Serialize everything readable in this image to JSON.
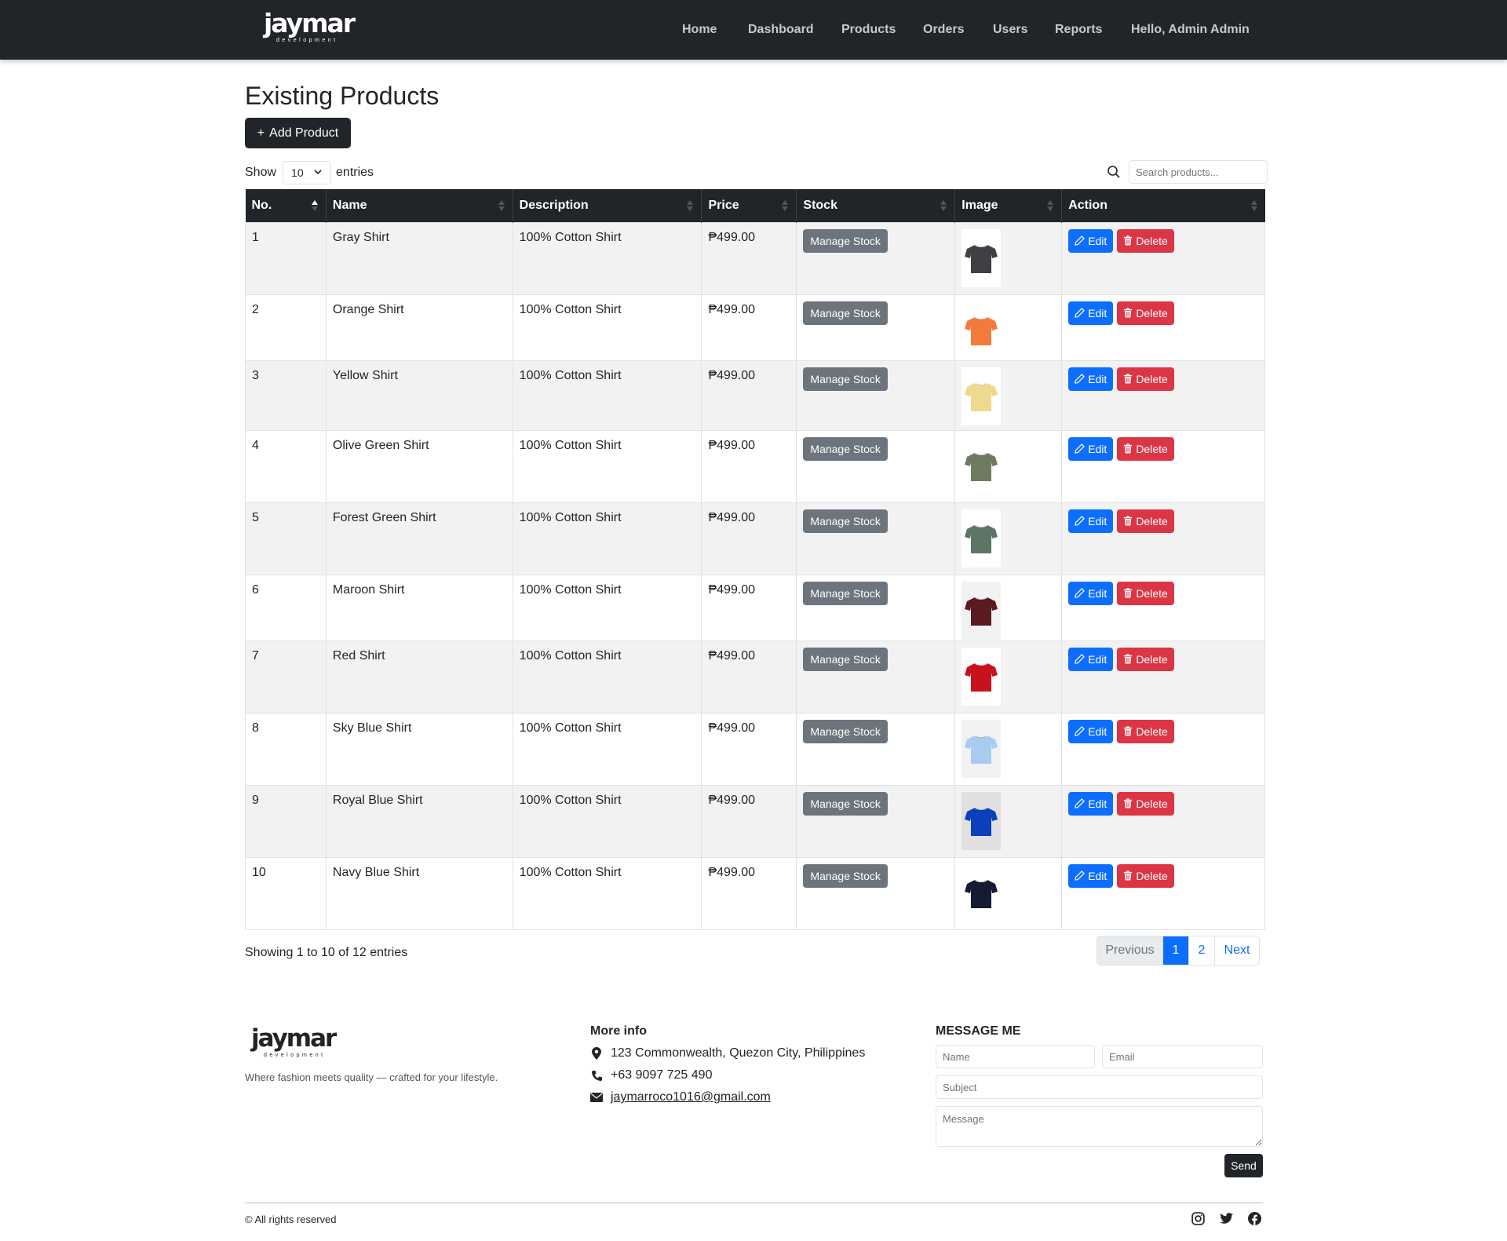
{
  "navbar": {
    "brand": "jaymar",
    "brand_sub": "development",
    "links": [
      "Home",
      "Dashboard",
      "Products",
      "Orders",
      "Users",
      "Reports",
      "Hello, Admin Admin"
    ]
  },
  "main": {
    "title": "Existing Products",
    "add_button": "Add Product",
    "show_label": "Show",
    "entries_label": "entries",
    "page_size": "10",
    "search_placeholder": "Search products...",
    "columns": [
      "No.",
      "Name",
      "Description",
      "Price",
      "Stock",
      "Image",
      "Action"
    ],
    "stock_button": "Manage Stock",
    "edit_button": "Edit",
    "delete_button": "Delete",
    "rows": [
      {
        "no": "1",
        "name": "Gray Shirt",
        "description": "100% Cotton Shirt",
        "price": "₱499.00",
        "color": "#3f3f44",
        "bg": "#ffffff"
      },
      {
        "no": "2",
        "name": "Orange Shirt",
        "description": "100% Cotton Shirt",
        "price": "₱499.00",
        "color": "#f47a3c",
        "bg": "#ffffff"
      },
      {
        "no": "3",
        "name": "Yellow Shirt",
        "description": "100% Cotton Shirt",
        "price": "₱499.00",
        "color": "#efd98c",
        "bg": "#ffffff"
      },
      {
        "no": "4",
        "name": "Olive Green Shirt",
        "description": "100% Cotton Shirt",
        "price": "₱499.00",
        "color": "#6e7b5e",
        "bg": "#ffffff"
      },
      {
        "no": "5",
        "name": "Forest Green Shirt",
        "description": "100% Cotton Shirt",
        "price": "₱499.00",
        "color": "#5d7563",
        "bg": "#ffffff"
      },
      {
        "no": "6",
        "name": "Maroon Shirt",
        "description": "100% Cotton Shirt",
        "price": "₱499.00",
        "color": "#5a1a1e",
        "bg": "#f2f2f2"
      },
      {
        "no": "7",
        "name": "Red Shirt",
        "description": "100% Cotton Shirt",
        "price": "₱499.00",
        "color": "#c9111d",
        "bg": "#ffffff"
      },
      {
        "no": "8",
        "name": "Sky Blue Shirt",
        "description": "100% Cotton Shirt",
        "price": "₱499.00",
        "color": "#a9cbef",
        "bg": "#f2f2f2"
      },
      {
        "no": "9",
        "name": "Royal Blue Shirt",
        "description": "100% Cotton Shirt",
        "price": "₱499.00",
        "color": "#0c3fb9",
        "bg": "#e0e0e0"
      },
      {
        "no": "10",
        "name": "Navy Blue Shirt",
        "description": "100% Cotton Shirt",
        "price": "₱499.00",
        "color": "#141b33",
        "bg": "#ffffff"
      }
    ],
    "info": "Showing 1 to 10 of 12 entries",
    "pager": {
      "previous": "Previous",
      "page1": "1",
      "page2": "2",
      "next": "Next"
    }
  },
  "footer": {
    "brand": "jaymar",
    "brand_sub": "development",
    "tagline": "Where fashion meets quality — crafted for your lifestyle.",
    "more_title": "More info",
    "address": "123 Commonwealth, Quezon City, Philippines",
    "phone": "+63 9097 725 490",
    "email": "jaymarroco1016@gmail.com",
    "message_title": "MESSAGE ME",
    "name_placeholder": "Name",
    "email_placeholder": "Email",
    "subject_placeholder": "Subject",
    "message_placeholder": "Message",
    "send_button": "Send",
    "copyright": "© All rights reserved",
    "social_icons": [
      "instagram-icon",
      "twitter-icon",
      "facebook-icon"
    ]
  },
  "colors": {
    "navbar_bg": "#212529",
    "primary": "#0d6efd",
    "danger": "#dc3545",
    "secondary": "#6c757d"
  }
}
